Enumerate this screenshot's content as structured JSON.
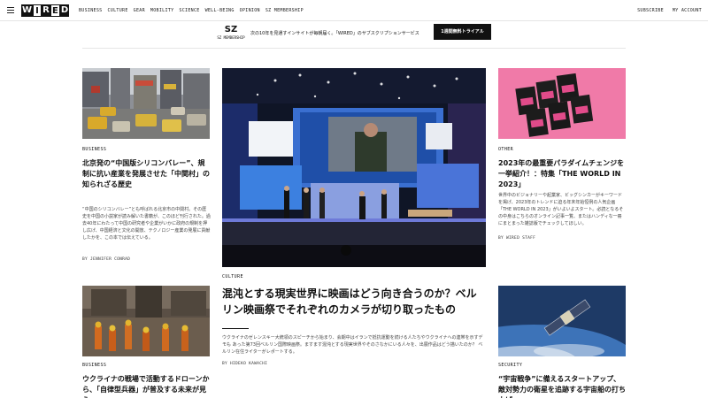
{
  "header": {
    "logo_letters": [
      "W",
      "I",
      "R",
      "E",
      "D"
    ],
    "nav": [
      "BUSINESS",
      "CULTURE",
      "GEAR",
      "MOBILITY",
      "SCIENCE",
      "WELL-BEING",
      "OPINION",
      "SZ MEMBERSHIP"
    ],
    "subscribe": "SUBSCRIBE",
    "account": "MY ACCOUNT"
  },
  "banner": {
    "logo_mark": "SZ",
    "logo_text": "SZ MEMBERSHIP",
    "copy": "次の10年を見通すインサイトが毎朝届く。「WIRED」のサブスクリプションサービス",
    "cta": "1週間無料トライアル"
  },
  "articles": {
    "left1": {
      "category": "BUSINESS",
      "title": "北京発の“中国版シリコンバレー”、規制に抗い産業を発展させた「中関村」の知られざる歴史",
      "excerpt": "“中国のシリコンバレー”とも呼ばれる北京市の中関村。その歴史を中国の小説家が読み解いた書籍が、このほど刊行された。過去40年にわたって中国の研究者や企業がいかに政府の規制を押し広げ、中国経済と文化の開放、テクノロジー産業の発展に貢献したかを、この本では伝えている。",
      "byline": "BY JENNIFER CONRAD"
    },
    "feature": {
      "category": "CULTURE",
      "title": "混沌とする現実世界に映画はどう向き合うのか？ベルリン映画祭でそれぞれのカメラが切り取ったもの",
      "excerpt": "ウクライナのゼレンスキー大統領のスピーチから始まり、会期中はイランで抵抗運動を続ける人たちやウクライナへの連帯を示すデモも あった第73回ベルリン国際映画祭。ますます混沌とする現実世界やそのさなかにいる人々を、出展作品はどう描いたのか？ ベルリン在住ライターがレポートする。",
      "byline": "BY HIDEKO KAWACHI"
    },
    "right1": {
      "category": "OTHER",
      "title": "2023年の最重要パラダイムチェンジを一挙紹介！：特集「THE WORLD IN 2023」",
      "excerpt": "世界中のビジョナリーや起業家、ビッグシンカーがキーワードを掲げ、2023年のトレンドに迫る年末年始恒例の人気企画「THE WORLD IN 2023」がいよいよスタート。必読となるその中身はこちらのオンライン記事一覧、またはハンディな一冊にまとまった雑誌版でチェックしてほしい。",
      "byline": "BY WIRED STAFF"
    },
    "left2": {
      "category": "BUSINESS",
      "title": "ウクライナの戦場で活動するドローンから、「自律型兵器」が普及する未来が見え"
    },
    "right2": {
      "category": "SECURITY",
      "title": "“宇宙戦争”に備えるスタートアップ、敵対勢力の衛星を追跡する宇宙船の打ち上げ"
    }
  }
}
